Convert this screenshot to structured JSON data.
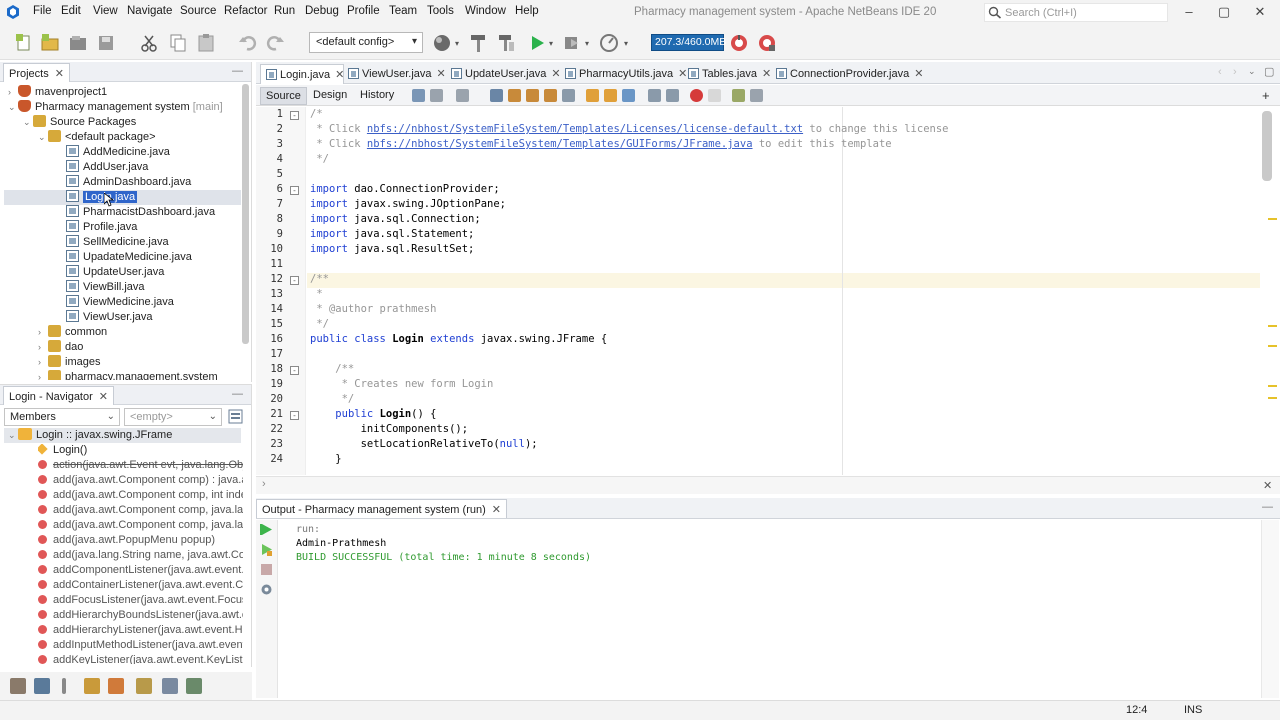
{
  "window": {
    "title": "Pharmacy management system - Apache NetBeans IDE 20",
    "search_placeholder": "Search (Ctrl+I)",
    "menu": [
      "File",
      "Edit",
      "View",
      "Navigate",
      "Source",
      "Refactor",
      "Run",
      "Debug",
      "Profile",
      "Team",
      "Tools",
      "Window",
      "Help"
    ]
  },
  "toolbar": {
    "config_value": "<default config>",
    "memory": "207.3/460.0MB"
  },
  "projects": {
    "tab_label": "Projects",
    "tree": [
      {
        "label": "mavenproject1",
        "icon": "cup-icon"
      },
      {
        "label": "Pharmacy management system",
        "suffix": "[main]",
        "icon": "cup-icon"
      },
      {
        "label": "Source Packages",
        "icon": "package-folder-icon"
      },
      {
        "label": "<default package>",
        "icon": "package-icon"
      },
      {
        "label": "AddMedicine.java",
        "icon": "java-file-icon"
      },
      {
        "label": "AddUser.java",
        "icon": "java-file-icon"
      },
      {
        "label": "AdminDashboard.java",
        "icon": "java-file-icon"
      },
      {
        "label": "Login.java",
        "icon": "java-file-icon",
        "selected": true
      },
      {
        "label": "PharmacistDashboard.java",
        "icon": "java-file-icon"
      },
      {
        "label": "Profile.java",
        "icon": "java-file-icon"
      },
      {
        "label": "SellMedicine.java",
        "icon": "java-file-icon"
      },
      {
        "label": "UpadateMedicine.java",
        "icon": "java-file-icon"
      },
      {
        "label": "UpdateUser.java",
        "icon": "java-file-icon"
      },
      {
        "label": "ViewBill.java",
        "icon": "java-file-icon"
      },
      {
        "label": "ViewMedicine.java",
        "icon": "java-file-icon"
      },
      {
        "label": "ViewUser.java",
        "icon": "java-file-icon"
      },
      {
        "label": "common",
        "icon": "package-icon"
      },
      {
        "label": "dao",
        "icon": "package-icon"
      },
      {
        "label": "images",
        "icon": "package-icon"
      },
      {
        "label": "pharmacy.management.system",
        "icon": "package-icon"
      }
    ]
  },
  "navigator": {
    "tab_label": "Login - Navigator",
    "filter_value": "Members",
    "empty_value": "<empty>",
    "root": "Login :: javax.swing.JFrame",
    "members": [
      {
        "label": "Login()",
        "kind": "constructor"
      },
      {
        "label": "action(java.awt.Event evt, java.lang.Object w",
        "kind": "deprecated"
      },
      {
        "label": "add(java.awt.Component comp) : java.awt.",
        "kind": "method"
      },
      {
        "label": "add(java.awt.Component comp, int index) :",
        "kind": "method"
      },
      {
        "label": "add(java.awt.Component comp, java.lang.C",
        "kind": "method"
      },
      {
        "label": "add(java.awt.Component comp, java.lang.C",
        "kind": "method"
      },
      {
        "label": "add(java.awt.PopupMenu popup)",
        "kind": "method"
      },
      {
        "label": "add(java.lang.String name, java.awt.Compo",
        "kind": "method"
      },
      {
        "label": "addComponentListener(java.awt.event.Con",
        "kind": "method"
      },
      {
        "label": "addContainerListener(java.awt.event.Conta",
        "kind": "method"
      },
      {
        "label": "addFocusListener(java.awt.event.FocusListe",
        "kind": "method"
      },
      {
        "label": "addHierarchyBoundsListener(java.awt.even",
        "kind": "method"
      },
      {
        "label": "addHierarchyListener(java.awt.event.Hierar",
        "kind": "method"
      },
      {
        "label": "addInputMethodListener(java.awt.event.Inp",
        "kind": "method"
      },
      {
        "label": "addKeyListener(java.awt.event.KeyListener l",
        "kind": "method"
      }
    ]
  },
  "editor": {
    "tabs": [
      "Login.java",
      "ViewUser.java",
      "UpdateUser.java",
      "PharmacyUtils.java",
      "Tables.java",
      "ConnectionProvider.java"
    ],
    "active_tab": "Login.java",
    "views": [
      "Source",
      "Design",
      "History"
    ],
    "active_view": "Source",
    "lines": [
      {
        "n": "1",
        "fold": "-",
        "parts": [
          {
            "t": "/*",
            "c": "cmt"
          }
        ]
      },
      {
        "n": "2",
        "parts": [
          {
            "t": " * Click ",
            "c": "cmt"
          },
          {
            "t": "nbfs://nbhost/SystemFileSystem/Templates/Licenses/license-default.txt",
            "c": "lnk"
          },
          {
            "t": " to change this license",
            "c": "cmt"
          }
        ]
      },
      {
        "n": "3",
        "parts": [
          {
            "t": " * Click ",
            "c": "cmt"
          },
          {
            "t": "nbfs://nbhost/SystemFileSystem/Templates/GUIForms/JFrame.java",
            "c": "lnk"
          },
          {
            "t": " to edit this template",
            "c": "cmt"
          }
        ]
      },
      {
        "n": "4",
        "parts": [
          {
            "t": " */",
            "c": "cmt"
          }
        ]
      },
      {
        "n": "5",
        "parts": []
      },
      {
        "n": "6",
        "fold": "-",
        "parts": [
          {
            "t": "import",
            "c": "kw"
          },
          {
            "t": " dao.ConnectionProvider;",
            "c": ""
          }
        ]
      },
      {
        "n": "7",
        "parts": [
          {
            "t": "import",
            "c": "kw"
          },
          {
            "t": " javax.swing.JOptionPane;",
            "c": ""
          }
        ]
      },
      {
        "n": "8",
        "parts": [
          {
            "t": "import",
            "c": "kw"
          },
          {
            "t": " java.sql.Connection;",
            "c": ""
          }
        ]
      },
      {
        "n": "9",
        "parts": [
          {
            "t": "import",
            "c": "kw"
          },
          {
            "t": " java.sql.Statement;",
            "c": ""
          }
        ]
      },
      {
        "n": "10",
        "parts": [
          {
            "t": "import",
            "c": "kw"
          },
          {
            "t": " java.sql.ResultSet;",
            "c": ""
          }
        ]
      },
      {
        "n": "11",
        "parts": []
      },
      {
        "n": "12",
        "fold": "-",
        "highlight": true,
        "parts": [
          {
            "t": "/**",
            "c": "cmt"
          }
        ]
      },
      {
        "n": "13",
        "parts": [
          {
            "t": " *",
            "c": "cmt"
          }
        ]
      },
      {
        "n": "14",
        "parts": [
          {
            "t": " * @author prathmesh",
            "c": "cmt"
          }
        ]
      },
      {
        "n": "15",
        "parts": [
          {
            "t": " */",
            "c": "cmt"
          }
        ]
      },
      {
        "n": "16",
        "parts": [
          {
            "t": "public",
            "c": "kw"
          },
          {
            "t": " ",
            "c": ""
          },
          {
            "t": "class",
            "c": "kw"
          },
          {
            "t": " ",
            "c": ""
          },
          {
            "t": "Login",
            "c": "ident"
          },
          {
            "t": " ",
            "c": ""
          },
          {
            "t": "extends",
            "c": "kw"
          },
          {
            "t": " javax.swing.JFrame {",
            "c": ""
          }
        ]
      },
      {
        "n": "17",
        "parts": []
      },
      {
        "n": "18",
        "fold": "-",
        "parts": [
          {
            "t": "    /**",
            "c": "cmt"
          }
        ]
      },
      {
        "n": "19",
        "parts": [
          {
            "t": "     * Creates new form Login",
            "c": "cmt"
          }
        ]
      },
      {
        "n": "20",
        "parts": [
          {
            "t": "     */",
            "c": "cmt"
          }
        ]
      },
      {
        "n": "21",
        "fold": "-",
        "parts": [
          {
            "t": "    ",
            "c": ""
          },
          {
            "t": "public",
            "c": "kw"
          },
          {
            "t": " ",
            "c": ""
          },
          {
            "t": "Login",
            "c": "ident"
          },
          {
            "t": "() {",
            "c": ""
          }
        ]
      },
      {
        "n": "22",
        "parts": [
          {
            "t": "        initComponents();",
            "c": ""
          }
        ]
      },
      {
        "n": "23",
        "parts": [
          {
            "t": "        setLocationRelativeTo(",
            "c": ""
          },
          {
            "t": "null",
            "c": "lit"
          },
          {
            "t": ");",
            "c": ""
          }
        ]
      },
      {
        "n": "24",
        "parts": [
          {
            "t": "    }",
            "c": ""
          }
        ]
      }
    ]
  },
  "output": {
    "tab_label": "Output - Pharmacy management system (run)",
    "lines": [
      {
        "t": "run:",
        "color": "#7a7a7a"
      },
      {
        "t": "Admin-Prathmesh",
        "color": "#000000"
      },
      {
        "t": "BUILD SUCCESSFUL (total time: 1 minute 8 seconds)",
        "color": "#2f9a2f"
      }
    ]
  },
  "status": {
    "position": "12:4",
    "mode": "INS"
  }
}
